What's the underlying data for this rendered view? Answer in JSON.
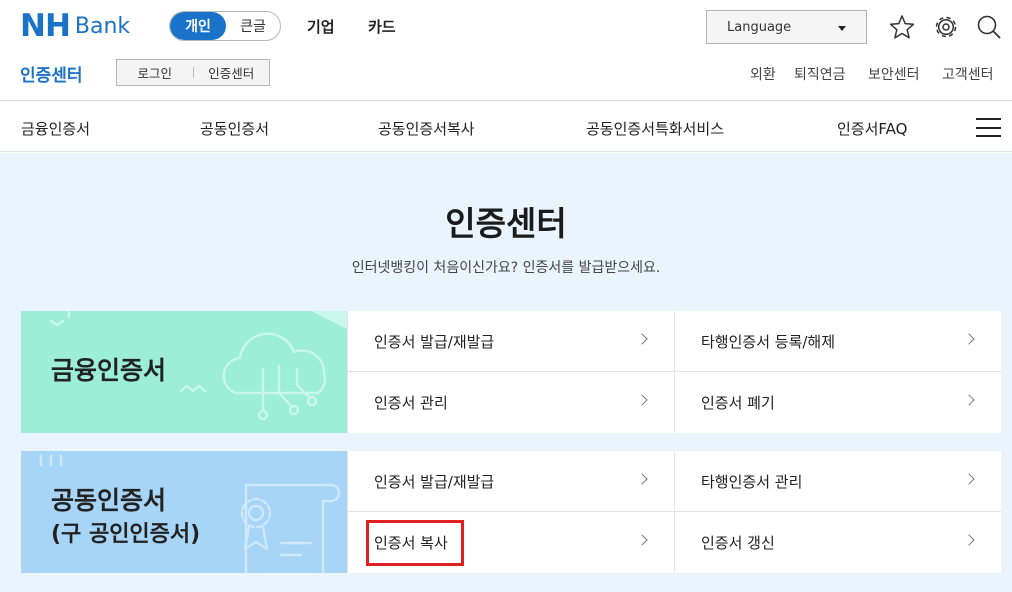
{
  "header": {
    "logo_nh": "NH",
    "logo_bank": "Bank",
    "segment": {
      "active": "개인",
      "inactive": "큰글"
    },
    "top_menu": [
      "기업",
      "카드"
    ],
    "language": "Language",
    "icons": [
      "star-icon",
      "gear-icon",
      "search-icon"
    ]
  },
  "subheader": {
    "title": "인증센터",
    "breadcrumb": [
      "로그인",
      "인증센터"
    ],
    "util_links": [
      "외환",
      "퇴직연금",
      "보안센터",
      "고객센터"
    ]
  },
  "gnb": {
    "items": [
      "금융인증서",
      "공동인증서",
      "공동인증서복사",
      "공동인증서특화서비스",
      "인증서FAQ"
    ],
    "menu_icon": "hamburger-icon"
  },
  "main": {
    "title": "인증센터",
    "description": "인터넷뱅킹이 처음이신가요? 인증서를 발급받으세요.",
    "panels": [
      {
        "title_line1": "금융인증서",
        "title_line2": "",
        "color": "#9deed6",
        "links": [
          "인증서 발급/재발급",
          "타행인증서 등록/해제",
          "인증서 관리",
          "인증서 폐기"
        ]
      },
      {
        "title_line1": "공동인증서",
        "title_line2": "(구 공인인증서)",
        "color": "#a7d5f7",
        "links": [
          "인증서 발급/재발급",
          "타행인증서 관리",
          "인증서 복사",
          "인증서 갱신"
        ]
      }
    ]
  },
  "colors": {
    "brand": "#1a73c8",
    "highlight": "#e02020"
  }
}
